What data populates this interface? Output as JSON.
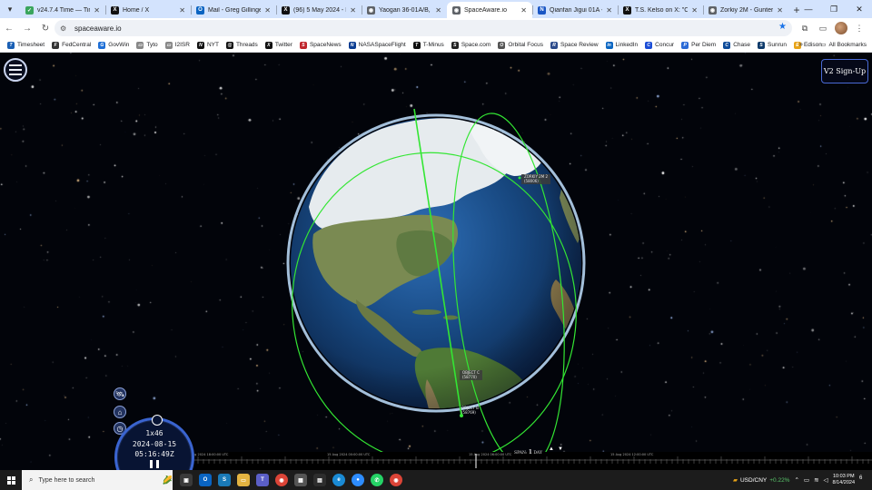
{
  "browser": {
    "tabs": [
      {
        "title": "v24.7.4 Time — Time",
        "icon": "clock-icon",
        "color": "#3aa55d",
        "glyph": "✓"
      },
      {
        "title": "Home / X",
        "icon": "x-icon",
        "color": "#111111",
        "glyph": "X"
      },
      {
        "title": "Mail - Greg Gillinger",
        "icon": "outlook-icon",
        "color": "#0a64c2",
        "glyph": "O"
      },
      {
        "title": "(96) 5 May 2024 - Fir",
        "icon": "x-icon",
        "color": "#111111",
        "glyph": "X"
      },
      {
        "title": "Yaogan 36-01A/B, 36",
        "icon": "globe-icon",
        "color": "#5f6368",
        "glyph": "◉"
      },
      {
        "title": "SpaceAware.io",
        "icon": "globe-icon",
        "color": "#5f6368",
        "glyph": "◉"
      },
      {
        "title": "Qianfan Jigui 01A - F",
        "icon": "n-icon",
        "color": "#1a56c4",
        "glyph": "N"
      },
      {
        "title": "T.S. Kelso on X: \"Cele",
        "icon": "x-icon",
        "color": "#111111",
        "glyph": "X"
      },
      {
        "title": "Zorkiy 2M - Gunter's",
        "icon": "globe-icon",
        "color": "#5f6368",
        "glyph": "◉"
      }
    ],
    "active_tab": 5,
    "new_tab": "+",
    "url": "spaceaware.io",
    "bookmarks": [
      {
        "label": "Timesheet",
        "color": "#1a5fb4",
        "glyph": "T"
      },
      {
        "label": "FedCentral",
        "color": "#333333",
        "glyph": "F"
      },
      {
        "label": "GovWin",
        "color": "#1f6fd6",
        "glyph": "G"
      },
      {
        "label": "Tyto",
        "color": "#888888",
        "glyph": "▭"
      },
      {
        "label": "I2ISR",
        "color": "#888888",
        "glyph": "▭"
      },
      {
        "label": "NYT",
        "color": "#111111",
        "glyph": "N"
      },
      {
        "label": "Threads",
        "color": "#111111",
        "glyph": "@"
      },
      {
        "label": "Twitter",
        "color": "#111111",
        "glyph": "X"
      },
      {
        "label": "SpaceNews",
        "color": "#c0262d",
        "glyph": "S"
      },
      {
        "label": "NASASpaceFlight",
        "color": "#0b3d91",
        "glyph": "N"
      },
      {
        "label": "T-Minus",
        "color": "#111111",
        "glyph": "T"
      },
      {
        "label": "Space.com",
        "color": "#222222",
        "glyph": "S"
      },
      {
        "label": "Orbital Focus",
        "color": "#555555",
        "glyph": "O"
      },
      {
        "label": "Space Review",
        "color": "#2b4a8b",
        "glyph": "R"
      },
      {
        "label": "LinkedIn",
        "color": "#0a66c2",
        "glyph": "in"
      },
      {
        "label": "Concur",
        "color": "#1b4dd6",
        "glyph": "C"
      },
      {
        "label": "Per Diem",
        "color": "#2a6ad6",
        "glyph": "P"
      },
      {
        "label": "Chase",
        "color": "#0e4c9a",
        "glyph": "C"
      },
      {
        "label": "Sunrun",
        "color": "#0f3b6b",
        "glyph": "S"
      },
      {
        "label": "Edison",
        "color": "#e8a317",
        "glyph": "E"
      }
    ],
    "all_bookmarks": "All Bookmarks"
  },
  "app": {
    "signup_label": "V2 Sign-Up",
    "satellites": [
      {
        "line1": "ZORKIY 2M 2",
        "line2": "(58006)"
      },
      {
        "line1": "OBJECT C",
        "line2": "(58770)"
      },
      {
        "line1": "OBJECT B",
        "line2": "(58769)"
      }
    ],
    "clock": {
      "speed": "1x46",
      "date": "2024-08-15",
      "time": "05:16:49Z"
    },
    "timeline_labels": [
      "14 Aug 2024 18:00:00 UTC",
      "15 Aug 2024 00:00:00 UTC",
      "15 Aug 2024 06:00:00 UTC",
      "15 Aug 2024 12:00:00 UTC"
    ],
    "span": {
      "prefix": "SPAN:",
      "value": "1",
      "unit": "DAY"
    },
    "colors": {
      "orbit": "#33e633",
      "clock_ring": "#3a64d0"
    }
  },
  "taskbar": {
    "search_placeholder": "Type here to search",
    "ticker": {
      "pair": "USD/CNY",
      "change": "+0.22%"
    },
    "time": "10:03 PM",
    "date": "8/14/2024",
    "notifications": "6"
  }
}
